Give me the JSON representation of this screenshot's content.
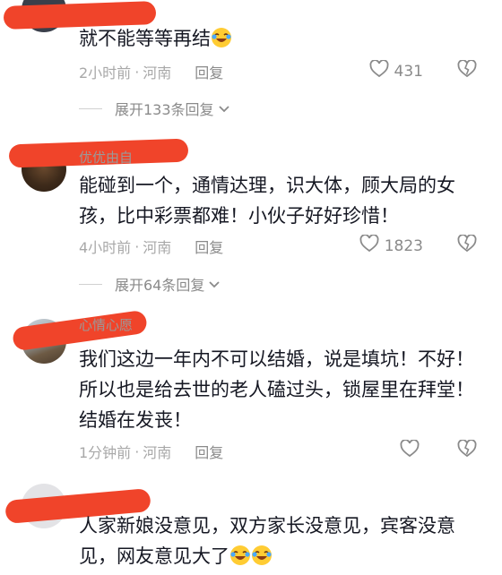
{
  "comments": [
    {
      "username": "",
      "text": "就不能等等再结",
      "time": "2小时前",
      "location": "河南",
      "reply_label": "回复",
      "likes": "431",
      "expand_label": "展开133条回复",
      "emoji": [
        "laugh-cry-emoji"
      ]
    },
    {
      "username": "优优由自",
      "text": "能碰到一个，通情达理，识大体，顾大局的女孩，比中彩票都难！小伙子好好珍惜！",
      "time": "4小时前",
      "location": "河南",
      "reply_label": "回复",
      "likes": "1823",
      "expand_label": "展开64条回复"
    },
    {
      "username": "心情心愿",
      "text": "我们这边一年内不可以结婚，说是填坑！不好！所以也是给去世的老人磕过头，锁屋里在拜堂！结婚在发丧！",
      "time": "1分钟前",
      "location": "河南",
      "reply_label": "回复",
      "likes": ""
    },
    {
      "username": "",
      "text": "人家新娘没意见，双方家长没意见，宾客没意见，网友意见大了",
      "emoji": [
        "laugh-cry-emoji",
        "laugh-cry-emoji"
      ]
    }
  ],
  "colors": {
    "scribble": "#f0442a",
    "meta": "#a8a8a8"
  }
}
